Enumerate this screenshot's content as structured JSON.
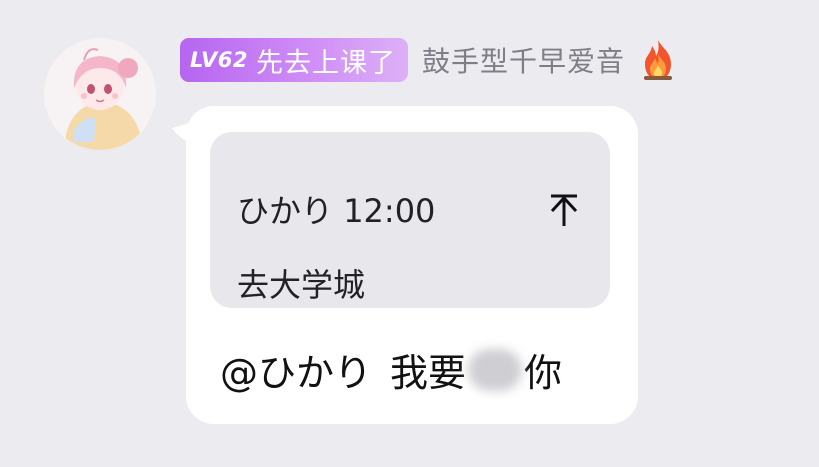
{
  "sender": {
    "level_number": "LV62",
    "level_title": "先去上课了",
    "name": "鼓手型千早爱音",
    "badge_icon": "fire-icon",
    "avatar": "anime-avatar"
  },
  "reply_quote": {
    "author": "ひかり",
    "time": "12:00",
    "arrow_icon": "arrow-to-top-icon",
    "text": "去大学城"
  },
  "message": {
    "mention": "@ひかり",
    "text_before_blur": "我要",
    "text_after_blur": "你"
  },
  "colors": {
    "background": "#ececf0",
    "bubble": "#ffffff",
    "quote_background": "#e8e8ec",
    "level_badge_start": "#b565f0",
    "level_badge_end": "#dcb0f7",
    "username": "#7e7e86"
  }
}
